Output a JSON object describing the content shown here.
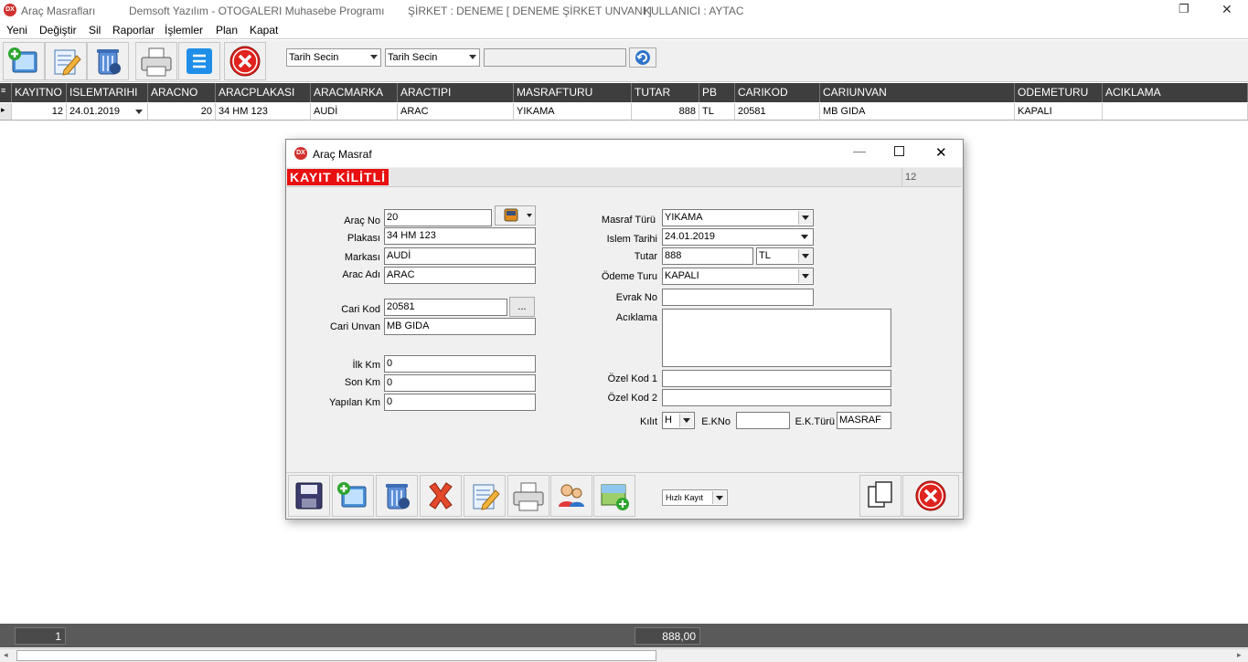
{
  "app": {
    "title": "Araç Masrafları",
    "vendor": "Demsoft Yazılım - OTOGALERI Muhasebe Programı",
    "company": "ŞİRKET : DENEME [ DENEME ŞİRKET UNVANI ]",
    "user": "KULLANICI : AYTAC",
    "logo": "DX"
  },
  "menu": [
    "Yeni",
    "Değiştir",
    "Sil",
    "Raporlar",
    "İşlemler",
    "Plan",
    "Kapat"
  ],
  "toolbar": {
    "date1": "Tarih Secin",
    "date2": "Tarih Secin",
    "search_value": "",
    "icons": [
      "add-record-icon",
      "edit-icon",
      "delete-icon",
      "print-icon",
      "list-icon",
      "close-icon",
      "refresh-icon"
    ]
  },
  "grid": {
    "columns": [
      "KAYITNO",
      "ISLEMTARIHI",
      "ARACNO",
      "ARACPLAKASI",
      "ARACMARKA",
      "ARACTIPI",
      "MASRAFTURU",
      "TUTAR",
      "PB",
      "CARIKOD",
      "CARIUNVAN",
      "ODEMETURU",
      "ACIKLAMA"
    ],
    "rows": [
      [
        "12",
        "24.01.2019",
        "20",
        "34 HM 123",
        "AUDİ",
        "ARAC",
        "YIKAMA",
        "888",
        "TL",
        "20581",
        "MB GIDA",
        "KAPALI",
        ""
      ]
    ]
  },
  "dialog": {
    "title": "Araç Masraf",
    "logo": "DX",
    "lock_banner": "KAYIT KİLİTLİ",
    "record_no": "12",
    "left": {
      "arac_no_label": "Araç No",
      "arac_no": "20",
      "plaka_label": "Plakası",
      "plaka": "34 HM 123",
      "marka_label": "Markası",
      "marka": "AUDİ",
      "arac_adi_label": "Arac Adı",
      "arac_adi": "ARAC",
      "cari_kod_label": "Cari Kod",
      "cari_kod": "20581",
      "cari_btn": "...",
      "cari_unvan_label": "Cari Unvan",
      "cari_unvan": "MB GIDA",
      "ilk_km_label": "İlk Km",
      "ilk_km": "0",
      "son_km_label": "Son Km",
      "son_km": "0",
      "yapilan_km_label": "Yapılan Km",
      "yapilan_km": "0"
    },
    "right": {
      "masraf_turu_label": "Masraf Türü",
      "masraf_turu": "YIKAMA",
      "islem_tarihi_label": "Islem Tarihi",
      "islem_tarihi": "24.01.2019",
      "tutar_label": "Tutar",
      "tutar": "888",
      "pb": "TL",
      "odeme_turu_label": "Ödeme Turu",
      "odeme_turu": "KAPALI",
      "evrak_no_label": "Evrak No",
      "evrak_no": "",
      "aciklama_label": "Acıklama",
      "aciklama": "",
      "ozel_kod1_label": "Özel Kod 1",
      "ozel_kod1": "",
      "ozel_kod2_label": "Özel Kod 2",
      "ozel_kod2": "",
      "kilit_label": "Kılıt",
      "kilit": "H",
      "ekno_label": "E.KNo",
      "ekno": "",
      "ekturu_label": "E.K.Türü",
      "ekturu": "MASRAF"
    },
    "hizli_kayit": "Hızlı Kayıt"
  },
  "footer": {
    "count": "1",
    "total": "888,00"
  },
  "colors": {
    "grid_header": "#3e3e3e",
    "lock_banner": "#e81010",
    "footer": "#5a5a5a"
  }
}
